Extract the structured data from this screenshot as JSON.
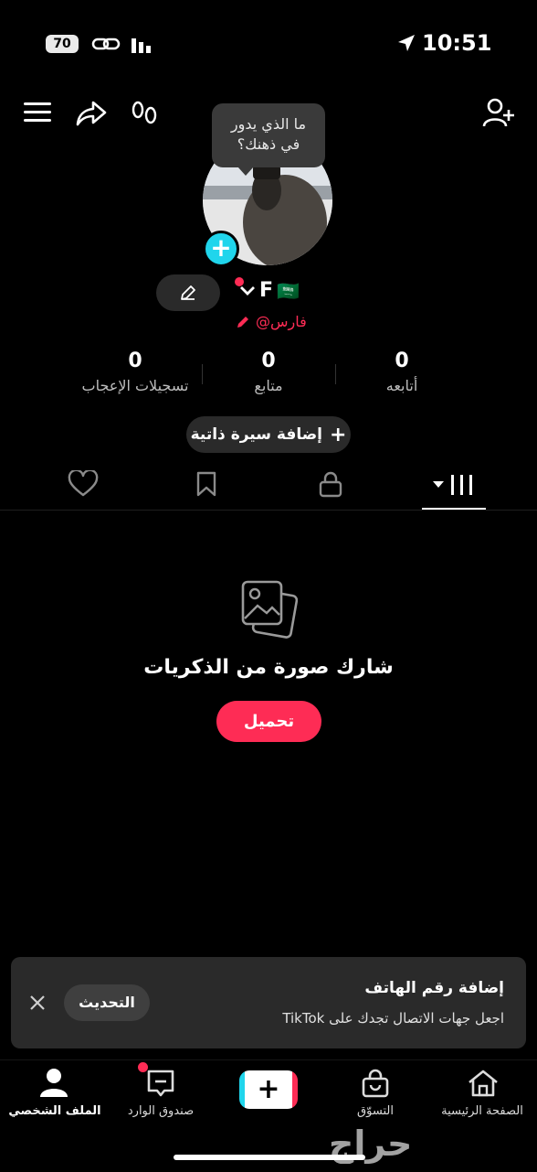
{
  "status_bar": {
    "time": "10:51",
    "battery": "70"
  },
  "header": {
    "tooltip_line1": "ما الذي يدور",
    "tooltip_line2": "في ذهنك؟"
  },
  "profile": {
    "username": "F",
    "flag": "🇸🇦",
    "handle": "@فارس"
  },
  "stats": [
    {
      "value": "0",
      "label": "أتابعه"
    },
    {
      "value": "0",
      "label": "متابع"
    },
    {
      "value": "0",
      "label": "تسجيلات الإعجاب"
    }
  ],
  "bio_button": {
    "label": "إضافة سيرة ذاتية",
    "icon": "+"
  },
  "tabs": [
    {
      "name": "videos",
      "icon": "grid-icon",
      "active": true
    },
    {
      "name": "private",
      "icon": "lock-icon"
    },
    {
      "name": "saved",
      "icon": "bookmark-icon"
    },
    {
      "name": "liked",
      "icon": "heart-icon"
    }
  ],
  "empty_state": {
    "title": "شارك صورة من الذكريات",
    "button": "تحميل"
  },
  "banner": {
    "title": "إضافة رقم الهاتف",
    "subtitle": "اجعل جهات الاتصال تجدك على TikTok",
    "button": "التحديث"
  },
  "nav": {
    "home": "الصفحة الرئيسية",
    "shop": "التسوّق",
    "create": "+",
    "inbox": "صندوق الوارد",
    "profile": "الملف الشخصي"
  },
  "watermark": "حراج",
  "colors": {
    "accent": "#fe2c55",
    "cyan": "#20d5ec"
  }
}
